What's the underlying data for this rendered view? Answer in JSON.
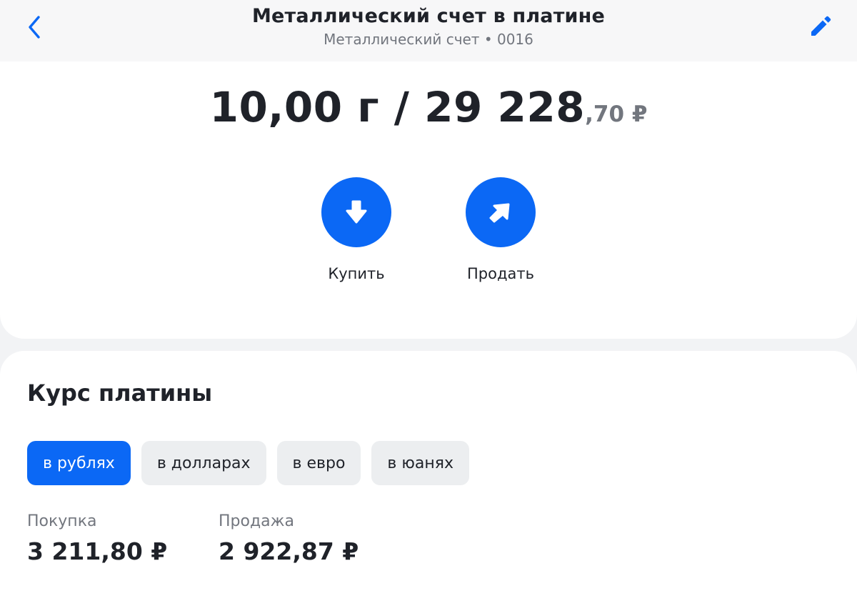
{
  "header": {
    "title": "Металлический счет в платине",
    "subtitle": "Металлический счет • 0016"
  },
  "balance": {
    "main": "10,00 г / 29 228",
    "fraction": ",70 ₽"
  },
  "actions": {
    "buy_label": "Купить",
    "sell_label": "Продать"
  },
  "rates": {
    "title": "Курс платины",
    "tabs": [
      {
        "label": "в рублях",
        "active": true
      },
      {
        "label": "в долларах",
        "active": false
      },
      {
        "label": "в евро",
        "active": false
      },
      {
        "label": "в юанях",
        "active": false
      }
    ],
    "buy": {
      "label": "Покупка",
      "value": "3 211,80 ₽"
    },
    "sell": {
      "label": "Продажа",
      "value": "2 922,87 ₽"
    }
  },
  "colors": {
    "accent": "#0b68f5",
    "text_primary": "#1f2229",
    "text_secondary": "#72767e",
    "background": "#f2f3f5",
    "tab_inactive": "#eceef0"
  },
  "icons": {
    "back": "chevron-left-icon",
    "edit": "pencil-icon",
    "buy": "arrow-down-icon",
    "sell": "arrow-up-right-icon"
  }
}
